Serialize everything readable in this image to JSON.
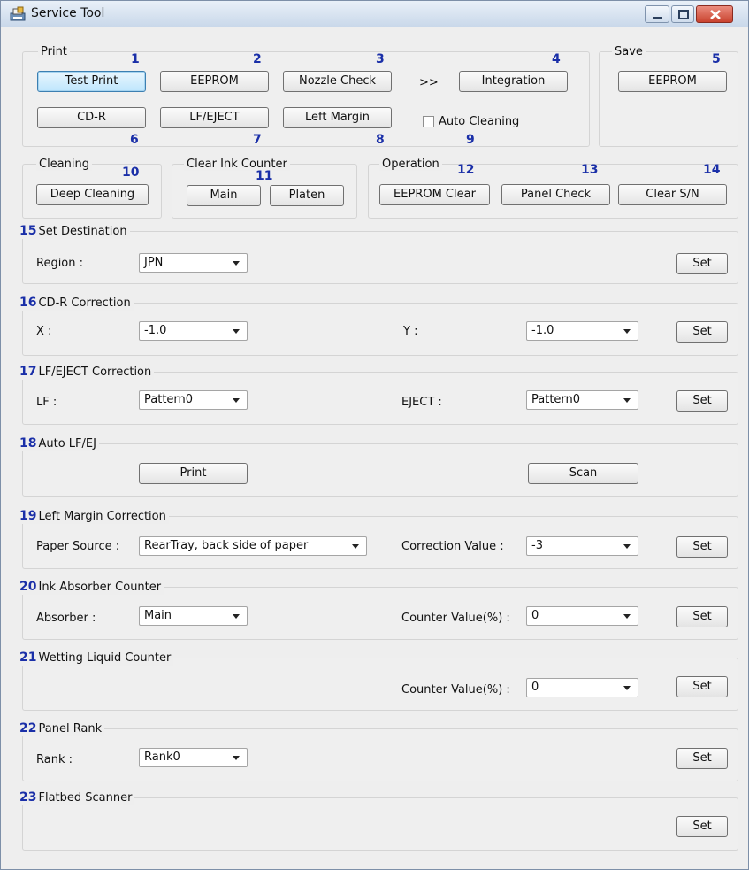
{
  "window": {
    "title": "Service Tool",
    "controls": [
      "minimize",
      "maximize",
      "close"
    ],
    "accent_number_color": "#1a2fa8"
  },
  "print": {
    "group_title": "Print",
    "numbers": [
      "1",
      "2",
      "3",
      "4",
      "6",
      "7",
      "8",
      "9"
    ],
    "buttons": {
      "test_print": "Test Print",
      "eeprom": "EEPROM",
      "nozzle_check": "Nozzle Check",
      "integration": "Integration",
      "cdr": "CD-R",
      "lf_eject": "LF/EJECT",
      "left_margin": "Left Margin"
    },
    "arrow": ">>",
    "auto_cleaning": "Auto Cleaning",
    "auto_cleaning_checked": false
  },
  "save": {
    "group_title": "Save",
    "number": "5",
    "button": "EEPROM"
  },
  "cleaning": {
    "group_title": "Cleaning",
    "number": "10",
    "button": "Deep Cleaning"
  },
  "clear_ink": {
    "group_title": "Clear Ink Counter",
    "number": "11",
    "main": "Main",
    "platen": "Platen"
  },
  "operation": {
    "group_title": "Operation",
    "numbers": [
      "12",
      "13",
      "14"
    ],
    "eeprom_clear": "EEPROM Clear",
    "panel_check": "Panel Check",
    "clear_sn": "Clear S/N"
  },
  "sections": {
    "s15": {
      "num": "15",
      "title": "Set Destination",
      "label": "Region :",
      "value": "JPN",
      "set": "Set"
    },
    "s16": {
      "num": "16",
      "title": "CD-R Correction",
      "label_x": "X :",
      "value_x": "-1.0",
      "label_y": "Y :",
      "value_y": "-1.0",
      "set": "Set"
    },
    "s17": {
      "num": "17",
      "title": "LF/EJECT Correction",
      "label_lf": "LF :",
      "value_lf": "Pattern0",
      "label_eject": "EJECT :",
      "value_eject": "Pattern0",
      "set": "Set"
    },
    "s18": {
      "num": "18",
      "title": "Auto LF/EJ",
      "print": "Print",
      "scan": "Scan"
    },
    "s19": {
      "num": "19",
      "title": "Left Margin Correction",
      "label_source": "Paper Source :",
      "value_source": "RearTray, back side of paper",
      "label_corr": "Correction Value :",
      "value_corr": "-3",
      "set": "Set"
    },
    "s20": {
      "num": "20",
      "title": "Ink Absorber Counter",
      "label_abs": "Absorber :",
      "value_abs": "Main",
      "label_counter": "Counter Value(%) :",
      "value_counter": "0",
      "set": "Set"
    },
    "s21": {
      "num": "21",
      "title": "Wetting Liquid Counter",
      "label_counter": "Counter Value(%) :",
      "value_counter": "0",
      "set": "Set"
    },
    "s22": {
      "num": "22",
      "title": "Panel Rank",
      "label_rank": "Rank :",
      "value_rank": "Rank0",
      "set": "Set"
    },
    "s23": {
      "num": "23",
      "title": "Flatbed Scanner",
      "set": "Set"
    }
  }
}
